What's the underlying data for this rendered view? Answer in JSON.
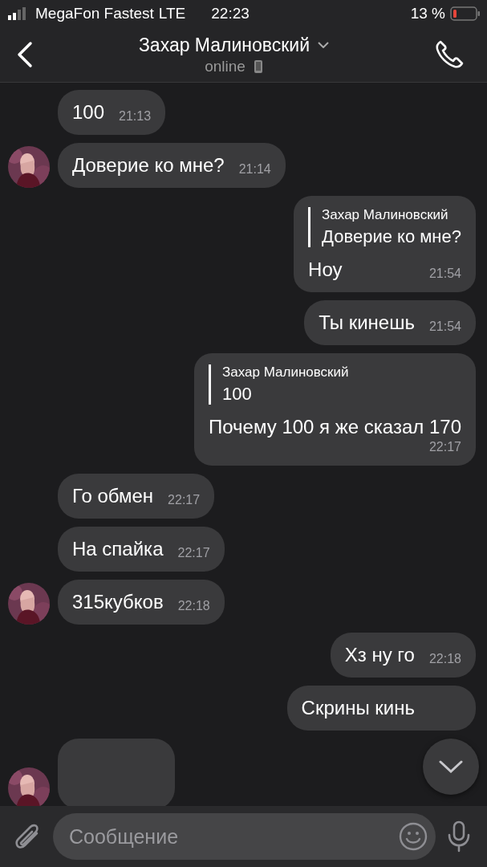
{
  "status_bar": {
    "carrier": "MegaFon Fastest",
    "network": "LTE",
    "time": "22:23",
    "battery": "13 %"
  },
  "header": {
    "title": "Захар Малиновский",
    "status": "online"
  },
  "messages": [
    {
      "kind": "incoming",
      "avatar": false,
      "text": "100",
      "time": "21:13"
    },
    {
      "kind": "incoming",
      "avatar": true,
      "text": "Доверие ко мне?",
      "time": "21:14"
    },
    {
      "kind": "outgoing",
      "reply": {
        "name": "Захар Малиновский",
        "text": "Доверие ко мне?"
      },
      "text": "Ноу",
      "time": "21:54"
    },
    {
      "kind": "outgoing",
      "text": "Ты кинешь",
      "time": "21:54"
    },
    {
      "kind": "outgoing",
      "reply": {
        "name": "Захар Малиновский",
        "text": "100"
      },
      "text": "Почему 100 я же сказал 170",
      "time": "22:17"
    },
    {
      "kind": "incoming",
      "avatar": false,
      "text": "Го обмен",
      "time": "22:17"
    },
    {
      "kind": "incoming",
      "avatar": false,
      "text": "На спайка",
      "time": "22:17"
    },
    {
      "kind": "incoming",
      "avatar": true,
      "text": "315кубков",
      "time": "22:18"
    },
    {
      "kind": "outgoing",
      "text": "Хз ну го",
      "time": "22:18"
    },
    {
      "kind": "outgoing",
      "text": "Скрины кинь"
    },
    {
      "kind": "incoming",
      "avatar": true
    }
  ],
  "composer": {
    "placeholder": "Сообщение"
  }
}
